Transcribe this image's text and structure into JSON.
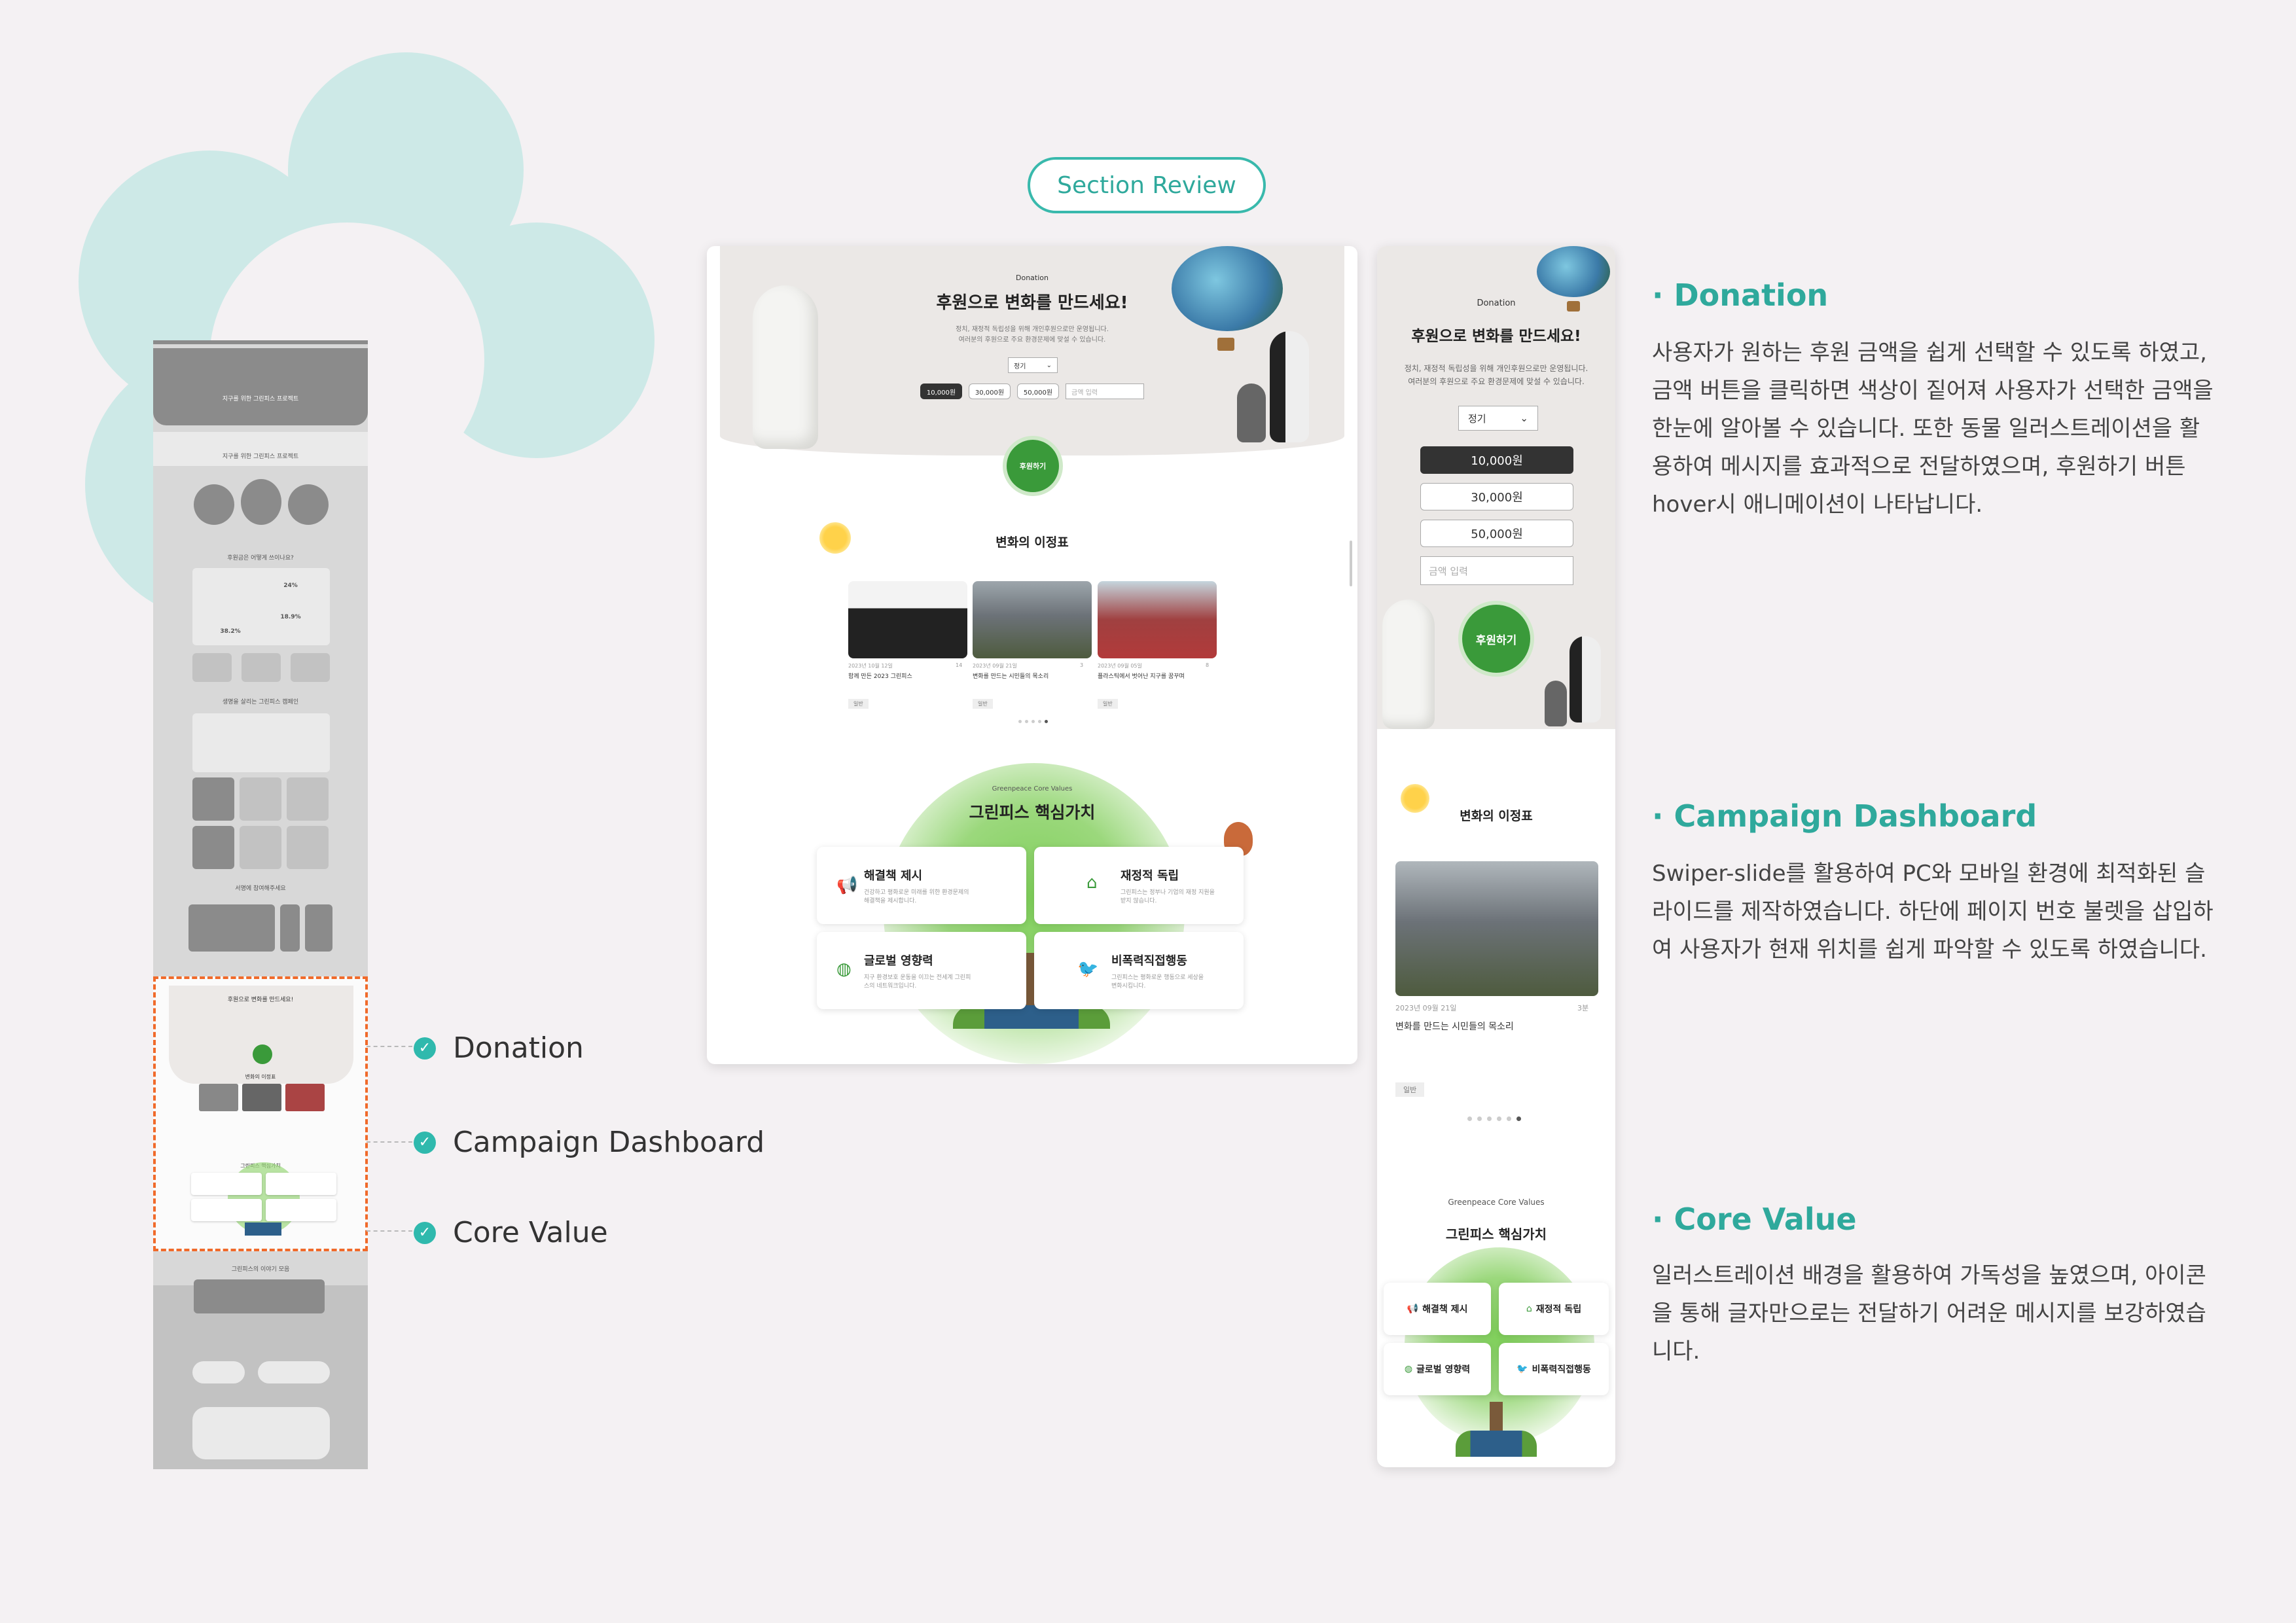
{
  "badge": "Section Review",
  "callouts": [
    "Donation",
    "Campaign Dashboard",
    "Core Value"
  ],
  "thumb": {
    "hero_caption": "지구를 위한 그린피스 프로젝트",
    "stats_title": "후원금은 어떻게 쓰이나요?",
    "stat_1": "38.2%",
    "stat_2": "24%",
    "stat_3": "18.9%",
    "campaign_title": "생명을 살리는 그린피스 캠페인",
    "join_title": "서명에 참여해주세요",
    "donation_title": "후원으로 변화를 만드세요!",
    "news_title": "변화의 이정표",
    "core_title": "그린피스 핵심가치",
    "recent_title": "그린피스의 이야기 모음"
  },
  "pc": {
    "eyebrow": "Donation",
    "title": "후원으로 변화를 만드세요!",
    "desc_1": "정치, 재정적 독립성을 위해 개인후원으로만 운영됩니다.",
    "desc_2": "여러분의 후원으로 주요 환경문제에 맞설 수 있습니다.",
    "select": "정기",
    "amounts": [
      "10,000원",
      "30,000원",
      "50,000원"
    ],
    "amount_placeholder": "금액 입력",
    "donate": "후원하기",
    "news_title": "변화의 이정표",
    "cards": [
      {
        "date": "2023년 10월 12일",
        "views": "14",
        "title": "함께 만든 2023 그린피스",
        "tag": "일반"
      },
      {
        "date": "2023년 09월 21일",
        "views": "3",
        "title": "변화를 만드는 시민들의 목소리",
        "tag": "일반"
      },
      {
        "date": "2023년 09월 05일",
        "views": "8",
        "title": "플라스틱에서 벗어난 지구를 꿈꾸며",
        "tag": "일반"
      }
    ],
    "core_eyebrow": "Greenpeace Core Values",
    "core_title": "그린피스 핵심가치",
    "values": [
      {
        "title": "해결책 제시",
        "desc": "건강하고 평화로운 미래를 위한 환경문제의 해결책을 제시합니다."
      },
      {
        "title": "재정적 독립",
        "desc": "그린피스는 정부나 기업의 재정 지원을 받지 않습니다."
      },
      {
        "title": "글로벌 영향력",
        "desc": "지구 환경보호 운동을 이끄는 전세계 그린피스의 네트워크입니다."
      },
      {
        "title": "비폭력직접행동",
        "desc": "그린피스는 평화로운 행동으로 세상을 변화시킵니다."
      }
    ]
  },
  "mobile": {
    "eyebrow": "Donation",
    "title": "후원으로 변화를 만드세요!",
    "desc_1": "정치, 재정적 독립성을 위해 개인후원으로만 운영됩니다.",
    "desc_2": "여러분의 후원으로 주요 환경문제에 맞설 수 있습니다.",
    "select": "정기",
    "amounts": [
      "10,000원",
      "30,000원",
      "50,000원"
    ],
    "amount_placeholder": "금액 입력",
    "donate": "후원하기",
    "news_title": "변화의 이정표",
    "card_date": "2023년 09월 21일",
    "card_views": "3분",
    "card_title": "변화를 만드는 시민들의 목소리",
    "card_tag": "일반",
    "core_eyebrow": "Greenpeace Core Values",
    "core_title": "그린피스 핵심가치",
    "values": [
      "해결책 제시",
      "재정적 독립",
      "글로벌 영향력",
      "비폭력직접행동"
    ]
  },
  "sections": [
    {
      "title": "· Donation",
      "desc": "사용자가 원하는 후원 금액을 쉽게 선택할 수 있도록 하였고, 금액 버튼을 클릭하면 색상이 짙어져 사용자가 선택한 금액을 한눈에 알아볼 수 있습니다. 또한 동물 일러스트레이션을 활용하여 메시지를 효과적으로 전달하였으며, 후원하기 버튼 hover시 애니메이션이 나타납니다."
    },
    {
      "title": "· Campaign Dashboard",
      "desc": "Swiper-slide를 활용하여 PC와 모바일 환경에 최적화된 슬라이드를 제작하였습니다. 하단에 페이지 번호 불렛을 삽입하여 사용자가 현재 위치를 쉽게 파악할 수 있도록 하였습니다."
    },
    {
      "title": "· Core Value",
      "desc": "일러스트레이션 배경을 활용하여 가독성을 높였으며, 아이콘을 통해 글자만으로는 전달하기 어려운 메시지를 보강하였습니다."
    }
  ],
  "colors": {
    "accent": "#2fa99c",
    "green": "#3a9a3a",
    "mint": "#cde9e7",
    "highlight": "#f06a2a"
  }
}
